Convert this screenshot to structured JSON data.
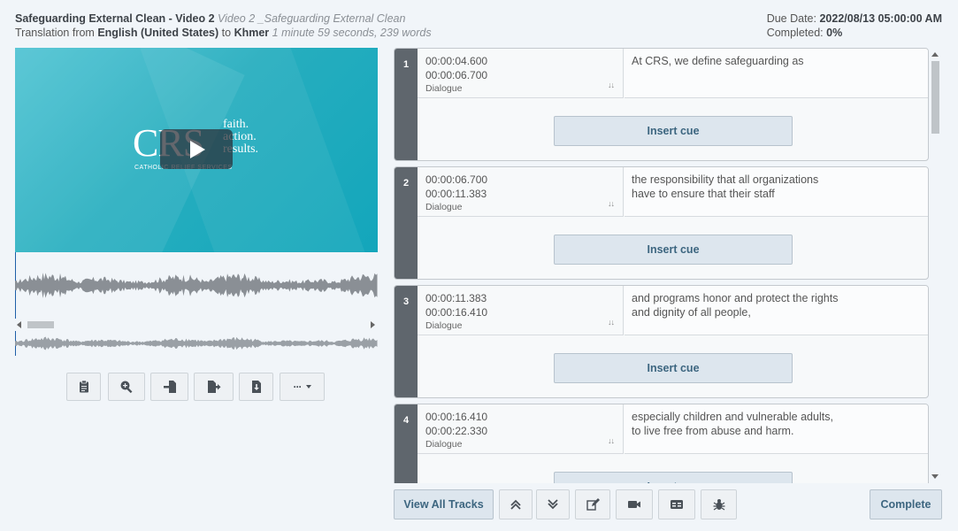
{
  "header": {
    "title": "Safeguarding External Clean - Video 2",
    "subtitle": "Video 2 _Safeguarding External Clean",
    "translation_prefix": "Translation from",
    "source_lang": "English (United States)",
    "to_word": "to",
    "target_lang": "Khmer",
    "duration_info": "1 minute 59 seconds, 239 words",
    "due_label": "Due Date:",
    "due_value": "2022/08/13 05:00:00 AM",
    "completed_label": "Completed:",
    "completed_value": "0%"
  },
  "video": {
    "logo_text": "CRS",
    "logo_tag_1": "faith.",
    "logo_tag_2": "action.",
    "logo_tag_3": "results.",
    "logo_sub": "CATHOLIC RELIEF SERVICES"
  },
  "toolbar": {
    "buttons": [
      "clipboard-icon",
      "zoom-in-icon",
      "import-icon",
      "export-icon",
      "download-icon",
      "more-icon"
    ],
    "more_label": "···"
  },
  "cues": [
    {
      "num": "1",
      "start": "00:00:04.600",
      "end": "00:00:06.700",
      "type": "Dialogue",
      "line1": "At CRS, we define safeguarding as",
      "line2": "",
      "insert": "Insert cue"
    },
    {
      "num": "2",
      "start": "00:00:06.700",
      "end": "00:00:11.383",
      "type": "Dialogue",
      "line1": "the responsibility that all organizations",
      "line2": "have to ensure that their staff",
      "insert": "Insert cue"
    },
    {
      "num": "3",
      "start": "00:00:11.383",
      "end": "00:00:16.410",
      "type": "Dialogue",
      "line1": "and programs honor and protect the rights",
      "line2": "and dignity of all people,",
      "insert": "Insert cue"
    },
    {
      "num": "4",
      "start": "00:00:16.410",
      "end": "00:00:22.330",
      "type": "Dialogue",
      "line1": "especially children and vulnerable adults,",
      "line2": "to live free from abuse and harm.",
      "insert": "Insert cue"
    }
  ],
  "sort_glyph": "↓↓",
  "bottom": {
    "view_all_tracks": "View All Tracks",
    "complete": "Complete"
  },
  "colors": {
    "accent": "#3d6680",
    "cue_number_bg": "#5f666d",
    "video_bg": "#27aebf"
  }
}
